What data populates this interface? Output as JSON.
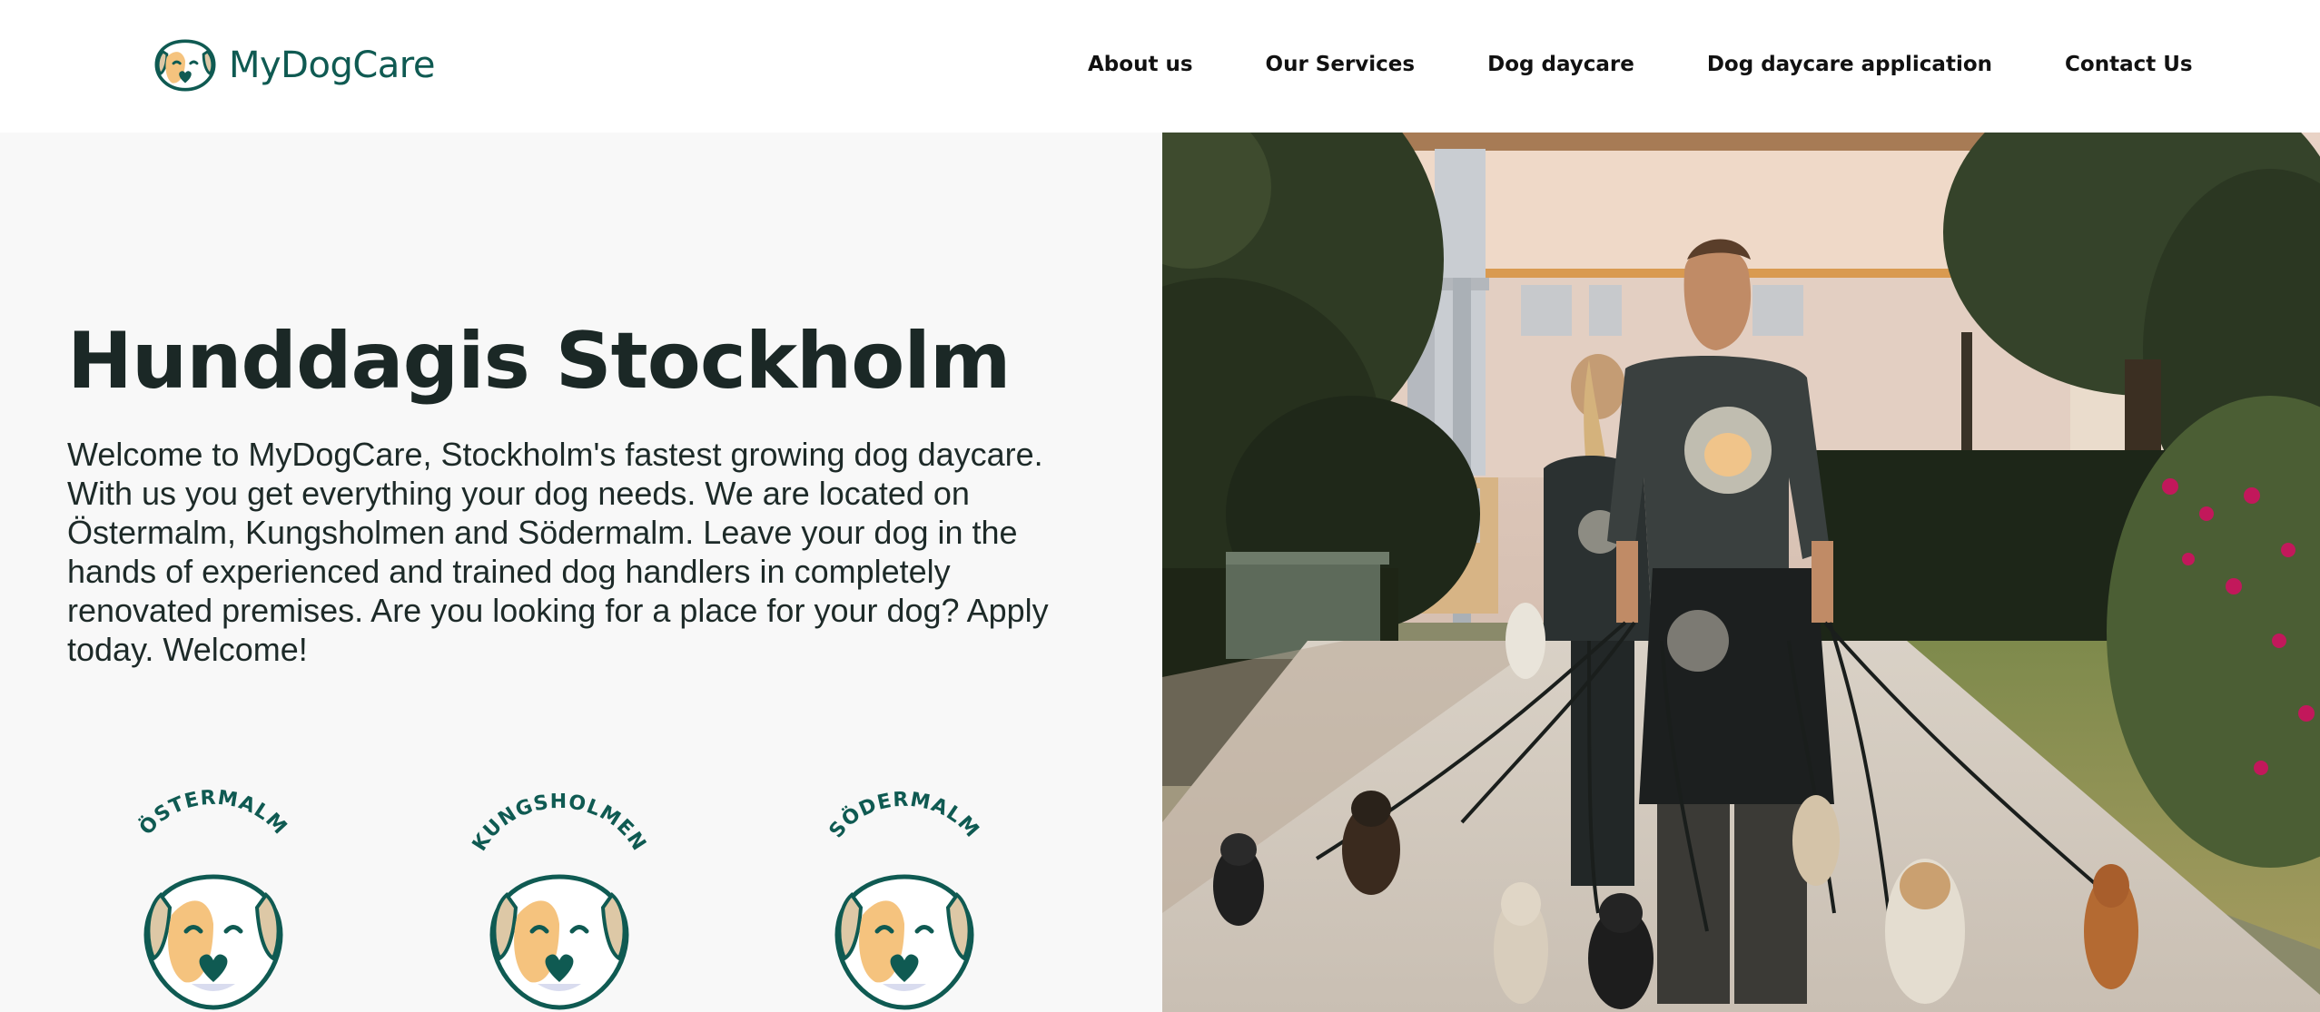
{
  "header": {
    "brand": {
      "name": "MyDogCare",
      "logo_icon": "dog-face-logo-icon"
    },
    "nav": [
      {
        "label": "About us"
      },
      {
        "label": "Our Services"
      },
      {
        "label": "Dog daycare"
      },
      {
        "label": "Dog daycare application"
      },
      {
        "label": "Contact Us"
      }
    ]
  },
  "hero": {
    "title": "Hunddagis Stockholm",
    "text": "Welcome to MyDogCare, Stockholm's fastest growing dog daycare. With us you get everything your dog needs. We are located on Östermalm, Kungsholmen and Södermalm. Leave your dog in the hands of experienced and trained dog handlers in completely renovated premises. Are you looking for a place for your dog? Apply today. Welcome!",
    "locations": [
      {
        "name": "ÖSTERMALM",
        "icon": "dog-face-badge-icon"
      },
      {
        "name": "KUNGSHOLMEN",
        "icon": "dog-face-badge-icon"
      },
      {
        "name": "SÖDERMALM",
        "icon": "dog-face-badge-icon"
      }
    ]
  },
  "photo": {
    "subject": "dog-walkers-photo"
  },
  "colors": {
    "brand_green": "#0f5a52",
    "dog_fur_orange": "#f5c37e",
    "dog_ear_beige": "#ddc8a6",
    "page_text": "#1b2826",
    "left_panel_bg": "#f8f8f8"
  }
}
